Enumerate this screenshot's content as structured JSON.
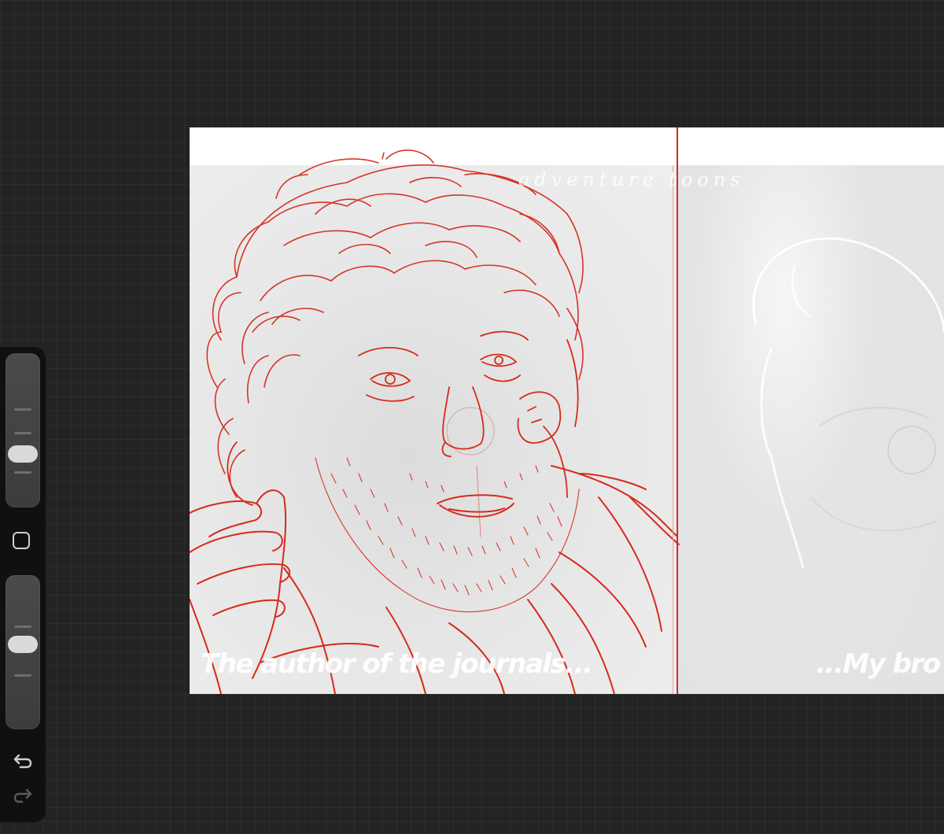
{
  "app": {
    "accent_color": "#d62a1c",
    "workspace_color": "#232323"
  },
  "canvas": {
    "watermark": "adventure toons",
    "caption_left": "The author of the journals...",
    "caption_right": "...My bro"
  },
  "sidebar": {
    "brush_size_slider": {
      "level": 0.45
    },
    "modify_button": {
      "icon": "square-icon"
    },
    "opacity_slider": {
      "level": 0.55
    },
    "undo": {
      "icon": "undo-icon"
    },
    "redo": {
      "icon": "redo-icon",
      "enabled": false
    }
  }
}
